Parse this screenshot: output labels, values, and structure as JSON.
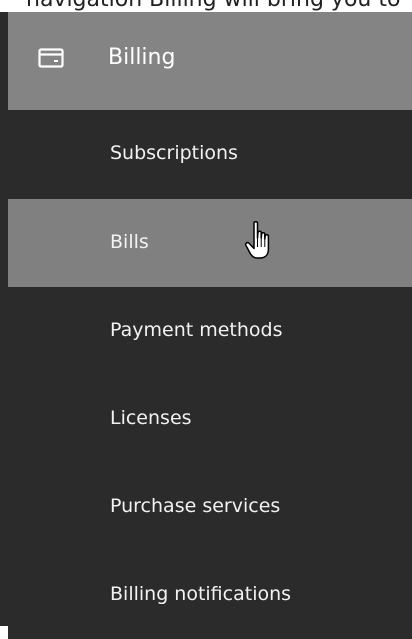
{
  "top_partial_text": "navigation Billing will bring you to",
  "sidebar": {
    "header": {
      "icon": "credit-card-icon",
      "label": "Billing"
    },
    "items": [
      {
        "label": "Subscriptions",
        "active": false
      },
      {
        "label": "Bills",
        "active": true
      },
      {
        "label": "Payment methods",
        "active": false
      },
      {
        "label": "Licenses",
        "active": false
      },
      {
        "label": "Purchase services",
        "active": false
      },
      {
        "label": "Billing notifications",
        "active": false
      }
    ]
  },
  "cursor": {
    "icon": "hand-pointer-cursor-icon"
  },
  "colors": {
    "sidebar_bg": "#2b2b2b",
    "header_bg": "#848484",
    "active_item_bg": "#808080",
    "text": "#f2f2f2"
  }
}
